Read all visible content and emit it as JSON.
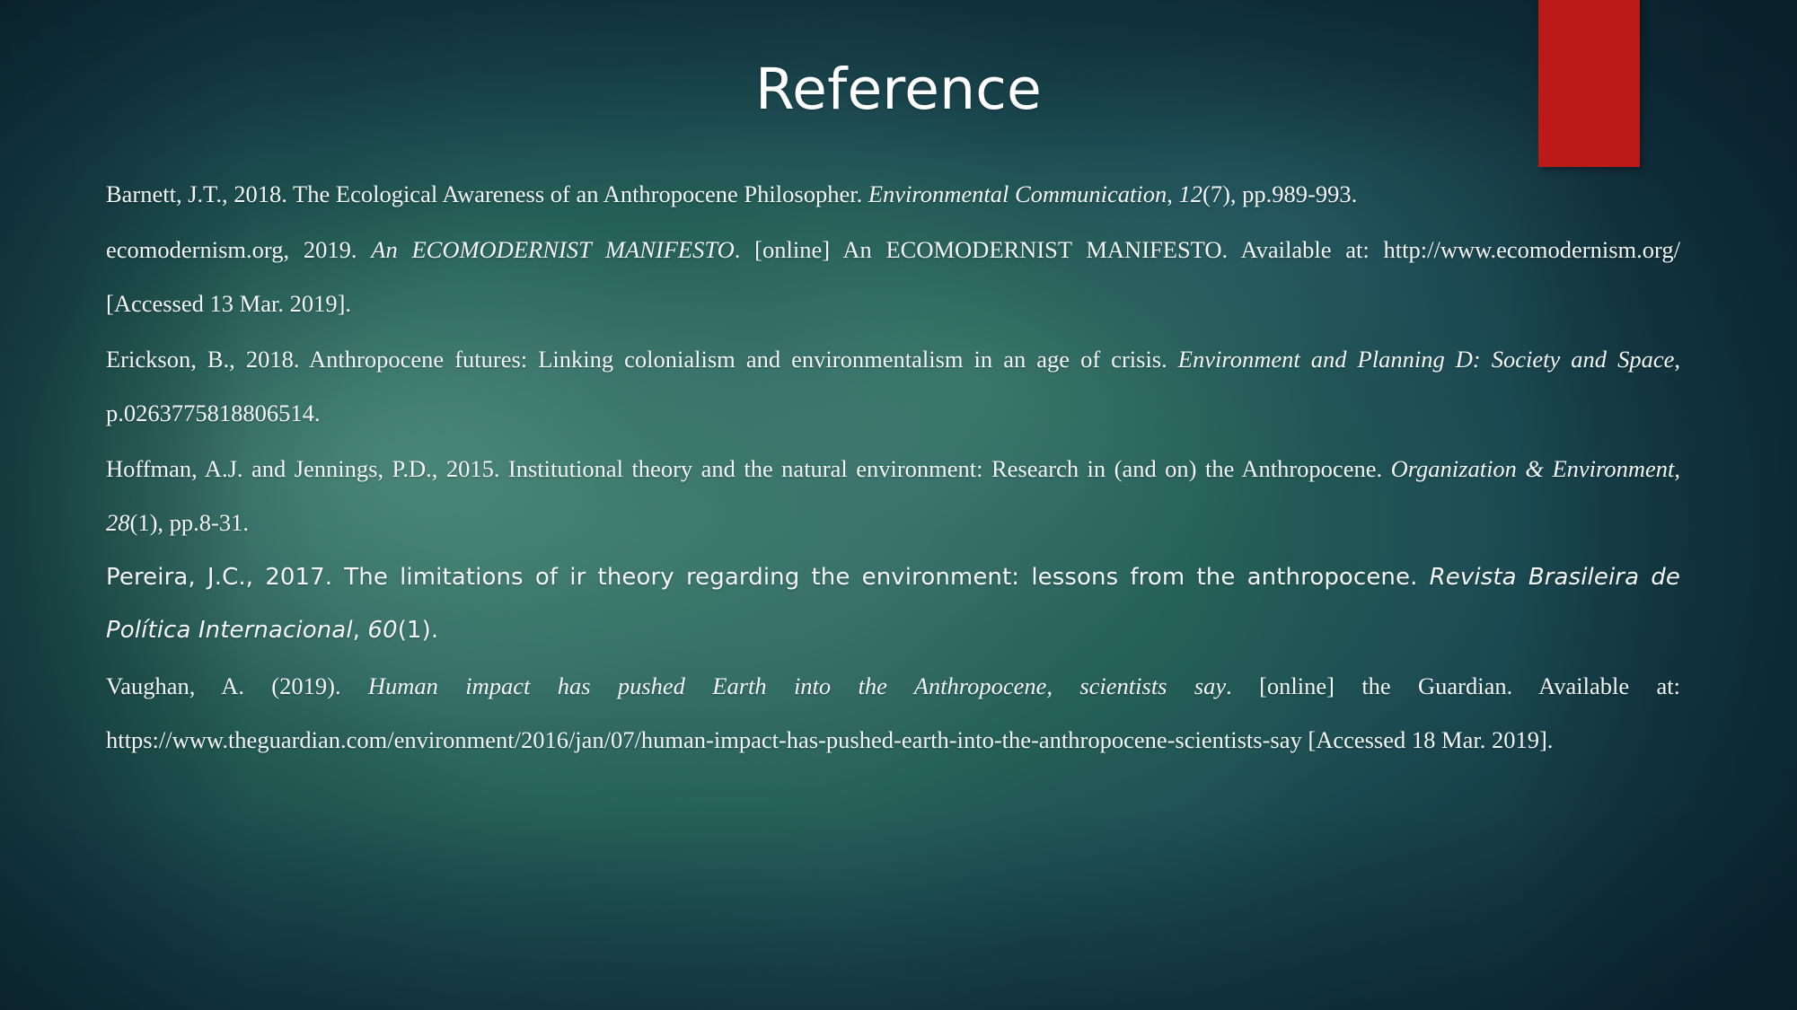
{
  "slide": {
    "title": "Reference",
    "accent_color": "#bb1a18",
    "background_color": "#17414b",
    "text_color": "#f4f6f5"
  },
  "references": [
    {
      "id": "barnett-2018",
      "font": "serif",
      "parts": [
        {
          "text": "Barnett, J.T., 2018. The Ecological Awareness of an Anthropocene Philosopher. ",
          "style": "regular"
        },
        {
          "text": "Environmental Communication",
          "style": "italic"
        },
        {
          "text": ", ",
          "style": "regular"
        },
        {
          "text": "12",
          "style": "italic"
        },
        {
          "text": "(7), pp.989-993.",
          "style": "regular"
        }
      ]
    },
    {
      "id": "ecomodernism-2019",
      "font": "serif",
      "parts": [
        {
          "text": "ecomodernism.org, 2019. ",
          "style": "regular"
        },
        {
          "text": "An ECOMODERNIST MANIFESTO",
          "style": "italic"
        },
        {
          "text": ". [online] An ECOMODERNIST MANIFESTO. Available at: http://www.ecomodernism.org/ [Accessed 13 Mar. 2019].",
          "style": "regular"
        }
      ]
    },
    {
      "id": "erickson-2018",
      "font": "serif",
      "parts": [
        {
          "text": "Erickson, B., 2018. Anthropocene futures: Linking colonialism and environmentalism in an age of crisis. ",
          "style": "regular"
        },
        {
          "text": "Environment and Planning D: Society and Space",
          "style": "italic"
        },
        {
          "text": ", p.0263775818806514.",
          "style": "regular"
        }
      ]
    },
    {
      "id": "hoffman-jennings-2015",
      "font": "serif",
      "parts": [
        {
          "text": "Hoffman, A.J. and Jennings, P.D., 2015. Institutional theory and the natural environment: Research in (and on) the Anthropocene. ",
          "style": "regular"
        },
        {
          "text": "Organization & Environment",
          "style": "italic"
        },
        {
          "text": ", ",
          "style": "regular"
        },
        {
          "text": "28",
          "style": "italic"
        },
        {
          "text": "(1), pp.8-31.",
          "style": "regular"
        }
      ]
    },
    {
      "id": "pereira-2017",
      "font": "sans",
      "parts": [
        {
          "text": "Pereira, J.C., 2017. The limitations of ir theory regarding the environment: lessons from the anthropocene. ",
          "style": "regular"
        },
        {
          "text": "Revista Brasileira de Política Internacional",
          "style": "italic"
        },
        {
          "text": ", ",
          "style": "regular"
        },
        {
          "text": "60",
          "style": "italic"
        },
        {
          "text": "(1).",
          "style": "regular"
        }
      ]
    },
    {
      "id": "vaughan-2019",
      "font": "serif",
      "parts": [
        {
          "text": "Vaughan, A. (2019). ",
          "style": "regular"
        },
        {
          "text": "Human impact has pushed Earth into the Anthropocene, scientists say",
          "style": "italic"
        },
        {
          "text": ". [online] the Guardian. Available at: https://www.theguardian.com/environment/2016/jan/07/human-impact-has-pushed-earth-into-the-anthropocene-scientists-say [Accessed 18 Mar. 2019].",
          "style": "regular"
        }
      ]
    }
  ]
}
